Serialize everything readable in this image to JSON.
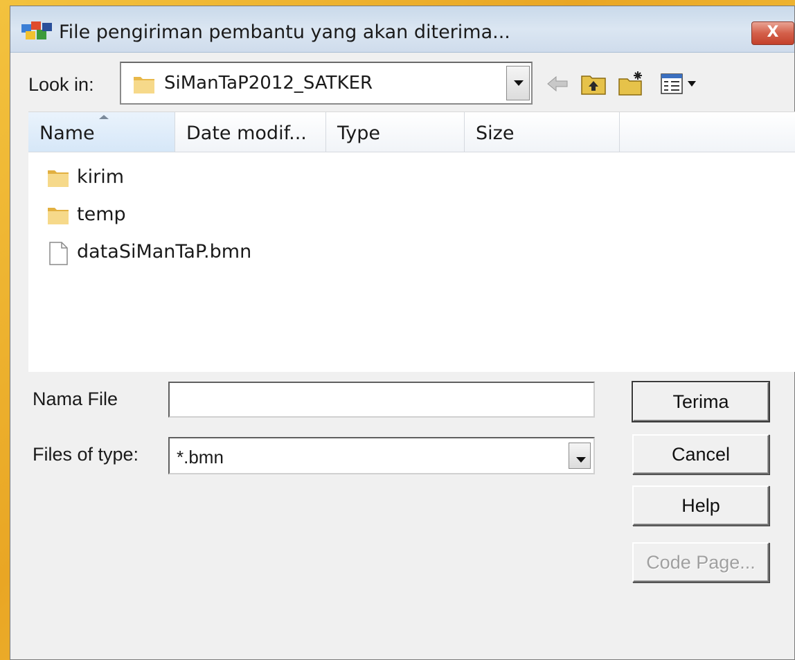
{
  "window": {
    "title": "File pengiriman pembantu yang akan diterima...",
    "close_label": "X"
  },
  "lookin": {
    "label": "Look in:",
    "value": "SiManTaP2012_SATKER"
  },
  "toolbar": {
    "icons": [
      "back-arrow-icon",
      "up-folder-icon",
      "new-folder-icon",
      "view-menu-icon"
    ]
  },
  "columns": [
    "Name",
    "Date modif...",
    "Type",
    "Size"
  ],
  "files": [
    {
      "name": "kirim",
      "icon": "folder-icon"
    },
    {
      "name": "temp",
      "icon": "folder-icon"
    },
    {
      "name": "dataSiManTaP.bmn",
      "icon": "file-icon"
    }
  ],
  "filename": {
    "label": "Nama File",
    "value": ""
  },
  "filetype": {
    "label": "Files of type:",
    "value": "*.bmn"
  },
  "buttons": {
    "accept": "Terima",
    "cancel": "Cancel",
    "help": "Help",
    "codepage": "Code Page..."
  },
  "colors": {
    "background": "#e9a624",
    "titlebar": "#cfdcec",
    "close": "#c4412c"
  }
}
